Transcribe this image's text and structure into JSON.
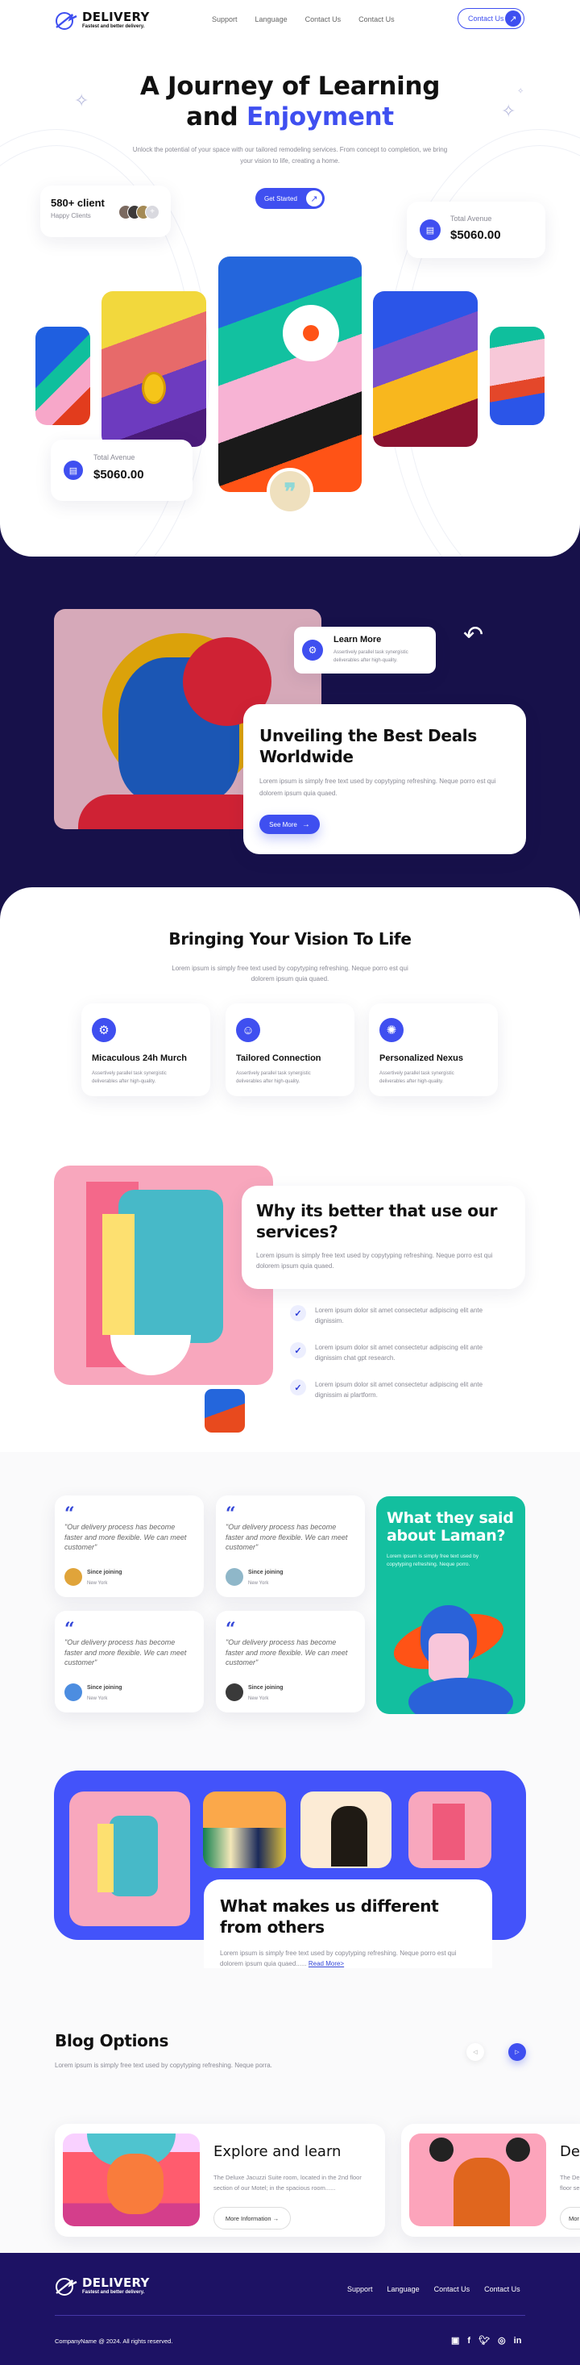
{
  "brand": {
    "name": "DELIVERY",
    "tagline": "Fastest and better delivery."
  },
  "nav": {
    "items": [
      "Support",
      "Language",
      "Contact Us",
      "Contact Us"
    ],
    "cta": "Contact Us"
  },
  "hero": {
    "title_line1": "A Journey of Learning",
    "title_line2_plain": "and",
    "title_line2_accent": "Enjoyment",
    "subtitle": "Unlock the potential of your space with our tailored remodeling services. From concept to completion, we bring your vision to life, creating a home.",
    "cta": "Get Started",
    "clients_card": {
      "value": "580+ client",
      "label": "Happy Clients",
      "more": "+"
    },
    "revenue_card_right": {
      "label": "Total Avenue",
      "value": "$5060.00"
    },
    "revenue_card_left": {
      "label": "Total Avenue",
      "value": "$5060.00"
    }
  },
  "deals": {
    "learn_more": {
      "title": "Learn More",
      "text": "Assertively parallel task synergistic deliverables after high-quality."
    },
    "title": "Unveiling the Best Deals Worldwide",
    "text": "Lorem ipsum is simply free text used by copytyping refreshing. Neque porro est qui dolorem ipsum quia quaed.",
    "cta": "See More"
  },
  "vision": {
    "title": "Bringing Your Vision To Life",
    "text": "Lorem ipsum is simply free text used by copytyping refreshing. Neque porro est qui dolorem ipsum quia quaed.",
    "features": [
      {
        "icon": "gear-icon",
        "title": "Micaculous 24h Murch",
        "text": "Assertively parallel task synergistic deliverables after high-quality."
      },
      {
        "icon": "head-icon",
        "title": "Tailored Connection",
        "text": "Assertively parallel task synergistic deliverables after high-quality."
      },
      {
        "icon": "brain-icon",
        "title": "Personalized Nexus",
        "text": "Assertively parallel task synergistic deliverables after high-quality."
      }
    ]
  },
  "why": {
    "title": "Why its better that use our services?",
    "text": "Lorem ipsum is simply free text used by copytyping refreshing. Neque porro est qui dolorem ipsum quia quaed.",
    "points": [
      "Lorem ipsum dolor sit amet consectetur adipiscing elit ante dignissim.",
      "Lorem ipsum dolor sit amet consectetur adipiscing elit ante dignissim chat gpt research.",
      "Lorem ipsum dolor sit amet consectetur adipiscing elit ante dignissim ai plartform."
    ]
  },
  "testimonials": {
    "items": [
      {
        "quote": "\"Our delivery process has become faster and more flexible. We can meet customer\"",
        "name": "Since joining",
        "location": "New York"
      },
      {
        "quote": "\"Our delivery process has become faster and more flexible. We can meet customer\"",
        "name": "Since joining",
        "location": "New York"
      },
      {
        "quote": "\"Our delivery process has become faster and more flexible. We can meet customer\"",
        "name": "Since joining",
        "location": "New York"
      },
      {
        "quote": "\"Our delivery process has become faster and more flexible. We can meet customer\"",
        "name": "Since joining",
        "location": "New York"
      }
    ],
    "side": {
      "title": "What they said about Laman?",
      "text": "Lorem ipsum is simply free text used by copytyping refreshing. Neque porro."
    }
  },
  "different": {
    "title": "What makes us different from others",
    "text": "Lorem ipsum is simply free text used by copytyping refreshing. Neque porro est qui dolorem ipsum quia quaed......",
    "link": "Read More>"
  },
  "blog": {
    "title": "Blog Options",
    "text": "Lorem ipsum is simply free text used by copytyping refreshing. Neque porra.",
    "cards": [
      {
        "title": "Explore and learn",
        "text": "The Deluxe Jacuzzi Suite room, located in the 2nd floor section of our Motel; in the spacious room......",
        "cta": "More Information →"
      },
      {
        "title": "De",
        "text": "The De floor se",
        "cta": "Mor"
      }
    ]
  },
  "footer": {
    "nav": [
      "Support",
      "Language",
      "Contact Us",
      "Contact Us"
    ],
    "copyright": "CompanyName @ 2024. All rights reserved.",
    "social": [
      "youtube-icon",
      "facebook-icon",
      "twitter-icon",
      "instagram-icon",
      "linkedin-icon"
    ]
  },
  "colors": {
    "accent": "#3f4ff0",
    "dark": "#17114a",
    "footer": "#1d1264",
    "teal": "#13bf9f"
  }
}
